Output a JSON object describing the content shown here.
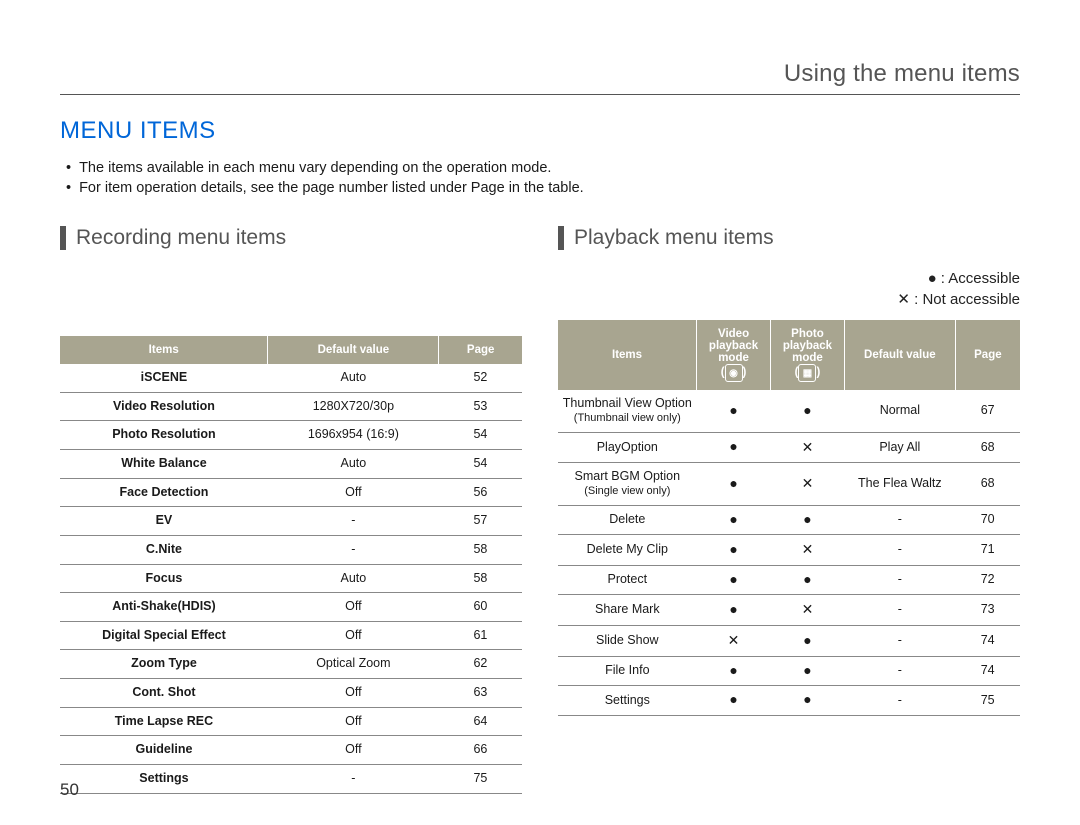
{
  "header": {
    "title": "Using the menu items"
  },
  "section": {
    "title": "Menu Items"
  },
  "bullets": [
    "The items available in each menu vary depending on the operation mode.",
    "For item operation details, see the page number listed under Page in the table."
  ],
  "recording": {
    "title": "Recording menu items",
    "columns": [
      "Items",
      "Default value",
      "Page"
    ],
    "rows": [
      {
        "item": "iSCENE",
        "default": "Auto",
        "page": "52"
      },
      {
        "item": "Video Resolution",
        "default": "1280X720/30p",
        "page": "53"
      },
      {
        "item": "Photo Resolution",
        "default": "1696x954 (16:9)",
        "page": "54"
      },
      {
        "item": "White Balance",
        "default": "Auto",
        "page": "54"
      },
      {
        "item": "Face Detection",
        "default": "Off",
        "page": "56"
      },
      {
        "item": "EV",
        "default": "-",
        "page": "57"
      },
      {
        "item": "C.Nite",
        "default": "-",
        "page": "58"
      },
      {
        "item": "Focus",
        "default": "Auto",
        "page": "58"
      },
      {
        "item": "Anti-Shake(HDIS)",
        "default": "Off",
        "page": "60"
      },
      {
        "item": "Digital Special Effect",
        "default": "Off",
        "page": "61"
      },
      {
        "item": "Zoom Type",
        "default": "Optical Zoom",
        "page": "62"
      },
      {
        "item": "Cont. Shot",
        "default": "Off",
        "page": "63"
      },
      {
        "item": "Time Lapse REC",
        "default": "Off",
        "page": "64"
      },
      {
        "item": "Guideline",
        "default": "Off",
        "page": "66"
      },
      {
        "item": "Settings",
        "default": "-",
        "page": "75"
      }
    ]
  },
  "playback": {
    "title": "Playback menu items",
    "legend": {
      "accessible": "● : Accessible",
      "not_accessible": "✕ : Not accessible"
    },
    "columns": {
      "items": "Items",
      "video_mode": "Video playback mode",
      "photo_mode": "Photo playback mode",
      "default": "Default value",
      "page": "Page"
    },
    "icons": {
      "video": "◉",
      "photo": "▦"
    },
    "rows": [
      {
        "item": "Thumbnail View Option",
        "sub": "(Thumbnail view only)",
        "video": "●",
        "photo": "●",
        "default": "Normal",
        "page": "67"
      },
      {
        "item": "PlayOption",
        "sub": "",
        "video": "●",
        "photo": "✕",
        "default": "Play All",
        "page": "68"
      },
      {
        "item": "Smart BGM Option",
        "sub": "(Single view only)",
        "video": "●",
        "photo": "✕",
        "default": "The Flea Waltz",
        "page": "68"
      },
      {
        "item": "Delete",
        "sub": "",
        "video": "●",
        "photo": "●",
        "default": "-",
        "page": "70"
      },
      {
        "item": "Delete My Clip",
        "sub": "",
        "video": "●",
        "photo": "✕",
        "default": "-",
        "page": "71"
      },
      {
        "item": "Protect",
        "sub": "",
        "video": "●",
        "photo": "●",
        "default": "-",
        "page": "72"
      },
      {
        "item": "Share Mark",
        "sub": "",
        "video": "●",
        "photo": "✕",
        "default": "-",
        "page": "73"
      },
      {
        "item": "Slide Show",
        "sub": "",
        "video": "✕",
        "photo": "●",
        "default": "-",
        "page": "74"
      },
      {
        "item": "File Info",
        "sub": "",
        "video": "●",
        "photo": "●",
        "default": "-",
        "page": "74"
      },
      {
        "item": "Settings",
        "sub": "",
        "video": "●",
        "photo": "●",
        "default": "-",
        "page": "75"
      }
    ]
  },
  "page_number": "50"
}
